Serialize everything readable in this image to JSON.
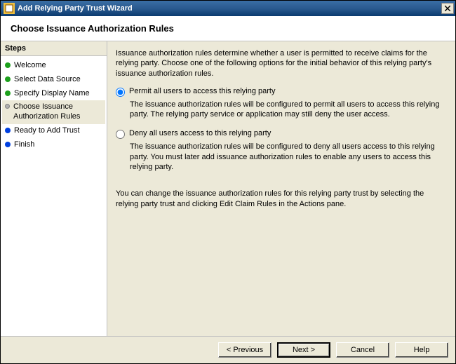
{
  "window": {
    "title": "Add Relying Party Trust Wizard"
  },
  "header": {
    "title": "Choose Issuance Authorization Rules"
  },
  "steps": {
    "header": "Steps",
    "items": [
      {
        "label": "Welcome",
        "bullet": "green"
      },
      {
        "label": "Select Data Source",
        "bullet": "green"
      },
      {
        "label": "Specify Display Name",
        "bullet": "green"
      },
      {
        "label": "Choose Issuance Authorization Rules",
        "bullet": "gray",
        "active": true
      },
      {
        "label": "Ready to Add Trust",
        "bullet": "blue"
      },
      {
        "label": "Finish",
        "bullet": "blue"
      }
    ]
  },
  "content": {
    "intro": "Issuance authorization rules determine whether a user is permitted to receive claims for the relying party. Choose one of the following options for the initial behavior of this relying party's issuance authorization rules.",
    "option1_label": "Permit all users to access this relying party",
    "option1_desc": "The issuance authorization rules will be configured to permit all users to access this relying party. The relying party service or application may still deny the user access.",
    "option2_label": "Deny all users access to this relying party",
    "option2_desc": "The issuance authorization rules will be configured to deny all users access to this relying party. You must later add issuance authorization rules to enable any users to access this relying party.",
    "footer_note": "You can change the issuance authorization rules for this relying party trust by selecting the relying party trust and clicking Edit Claim Rules in the Actions pane.",
    "selected": "permit"
  },
  "buttons": {
    "previous": "< Previous",
    "next": "Next >",
    "cancel": "Cancel",
    "help": "Help"
  }
}
